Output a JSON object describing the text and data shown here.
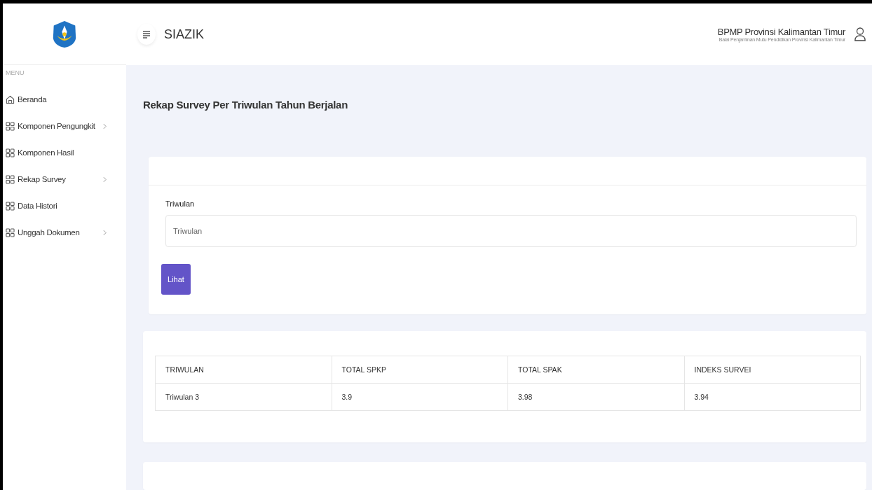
{
  "header": {
    "app_title": "SIAZIK",
    "org_name": "BPMP Provinsi Kalimantan Timur",
    "org_subtitle": "Balai Penjaminan Mutu Pendidikan Provinsi Kalimantan Timur"
  },
  "sidebar": {
    "section_label": "MENU",
    "items": [
      {
        "label": "Beranda",
        "kind": "home",
        "has_submenu": false
      },
      {
        "label": "Komponen Pengungkit",
        "kind": "grid",
        "has_submenu": true
      },
      {
        "label": "Komponen Hasil",
        "kind": "grid",
        "has_submenu": false
      },
      {
        "label": "Rekap Survey",
        "kind": "grid",
        "has_submenu": true
      },
      {
        "label": "Data Histori",
        "kind": "grid",
        "has_submenu": false
      },
      {
        "label": "Unggah Dokumen",
        "kind": "grid",
        "has_submenu": true
      }
    ]
  },
  "page_title": "Rekap Survey Per Triwulan Tahun Berjalan",
  "form": {
    "field_label": "Triwulan",
    "placeholder": "Triwulan",
    "button": "Lihat"
  },
  "table": {
    "columns": [
      "TRIWULAN",
      "TOTAL SPKP",
      "TOTAL SPAK",
      "INDEKS SURVEI"
    ],
    "rows": [
      [
        "Triwulan 3",
        "3.9",
        "3.98",
        "3.94"
      ]
    ]
  }
}
